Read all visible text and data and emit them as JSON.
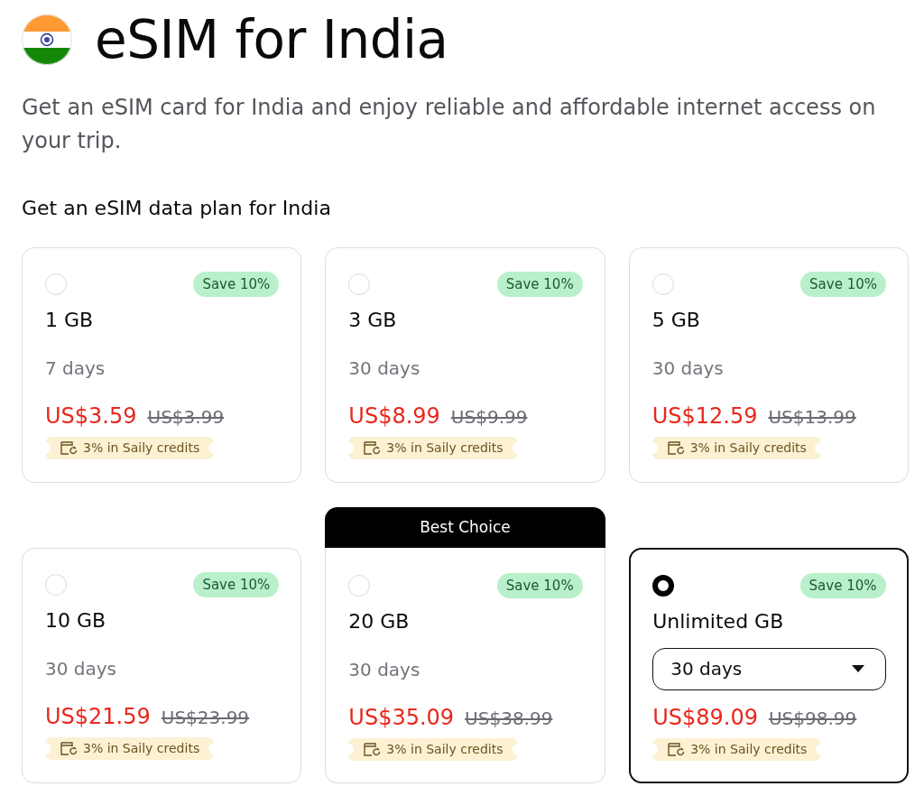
{
  "header": {
    "title": "eSIM for India",
    "description": "Get an eSIM card for India and enjoy reliable and affordable internet access on your trip."
  },
  "section_title": "Get an eSIM data plan for India",
  "plans": [
    {
      "kind": "text",
      "selected": false,
      "discount": "Save 10%",
      "data": "1 GB",
      "duration": "7 days",
      "price": "US$3.59",
      "old_price": "US$3.99",
      "credits": "3% in Saily credits"
    },
    {
      "kind": "text",
      "selected": false,
      "discount": "Save 10%",
      "data": "3 GB",
      "duration": "30 days",
      "price": "US$8.99",
      "old_price": "US$9.99",
      "credits": "3% in Saily credits"
    },
    {
      "kind": "text",
      "selected": false,
      "discount": "Save 10%",
      "data": "5 GB",
      "duration": "30 days",
      "price": "US$12.59",
      "old_price": "US$13.99",
      "credits": "3% in Saily credits"
    },
    {
      "kind": "text",
      "selected": false,
      "discount": "Save 10%",
      "data": "10 GB",
      "duration": "30 days",
      "price": "US$21.59",
      "old_price": "US$23.99",
      "credits": "3% in Saily credits"
    },
    {
      "kind": "text",
      "selected": false,
      "banner": "Best Choice",
      "discount": "Save 10%",
      "data": "20 GB",
      "duration": "30 days",
      "price": "US$35.09",
      "old_price": "US$38.99",
      "credits": "3% in Saily credits"
    },
    {
      "kind": "dropdown",
      "selected": true,
      "discount": "Save 10%",
      "data": "Unlimited GB",
      "duration": "30 days",
      "price": "US$89.09",
      "old_price": "US$98.99",
      "credits": "3% in Saily credits"
    }
  ]
}
